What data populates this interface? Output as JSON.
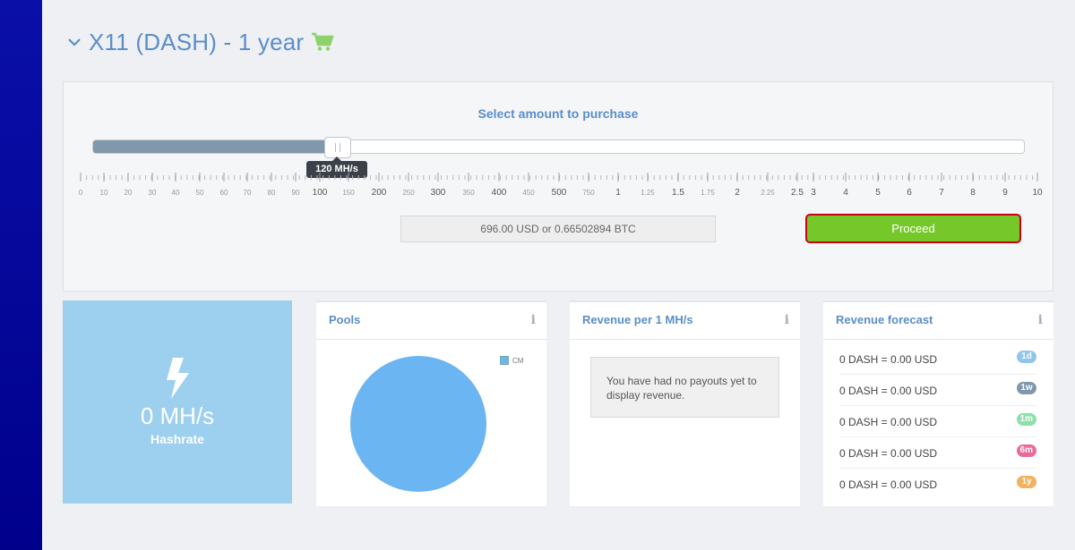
{
  "header": {
    "title": "X11 (DASH) - 1 year"
  },
  "purchase": {
    "label": "Select amount to purchase",
    "tooltip": "120 MH/s",
    "slider_fraction": 0.262,
    "scale_major": [
      {
        "label": "0",
        "kind": "small"
      },
      {
        "label": "10",
        "kind": "small"
      },
      {
        "label": "20",
        "kind": "small"
      },
      {
        "label": "30",
        "kind": "small"
      },
      {
        "label": "40",
        "kind": "small"
      },
      {
        "label": "50",
        "kind": "small"
      },
      {
        "label": "60",
        "kind": "small"
      },
      {
        "label": "70",
        "kind": "small"
      },
      {
        "label": "80",
        "kind": "small"
      },
      {
        "label": "90",
        "kind": "small"
      },
      {
        "label": "100",
        "kind": "big"
      },
      {
        "label": "150",
        "kind": "small"
      },
      {
        "label": "200",
        "kind": "big"
      },
      {
        "label": "250",
        "kind": "small"
      },
      {
        "label": "300",
        "kind": "big"
      },
      {
        "label": "350",
        "kind": "small"
      },
      {
        "label": "400",
        "kind": "big"
      },
      {
        "label": "450",
        "kind": "small"
      },
      {
        "label": "500",
        "kind": "big"
      },
      {
        "label": "750",
        "kind": "small"
      },
      {
        "label": "1",
        "kind": "big"
      },
      {
        "label": "1.25",
        "kind": "small"
      },
      {
        "label": "1.5",
        "kind": "big"
      },
      {
        "label": "1.75",
        "kind": "small"
      },
      {
        "label": "2",
        "kind": "big"
      },
      {
        "label": "2.25",
        "kind": "small"
      },
      {
        "label": "2.5",
        "kind": "big"
      },
      {
        "label": "3",
        "kind": "big"
      },
      {
        "label": "4",
        "kind": "big"
      },
      {
        "label": "5",
        "kind": "big"
      },
      {
        "label": "6",
        "kind": "big"
      },
      {
        "label": "7",
        "kind": "big"
      },
      {
        "label": "8",
        "kind": "big"
      },
      {
        "label": "9",
        "kind": "big"
      },
      {
        "label": "10",
        "kind": "big"
      }
    ],
    "price": "696.00 USD or 0.66502894 BTC",
    "proceed_label": "Proceed"
  },
  "hashrate": {
    "value": "0 MH/s",
    "label": "Hashrate",
    "icon": "bolt-icon"
  },
  "pools": {
    "title": "Pools",
    "legend": "CM",
    "color": "#6bb5f2",
    "info_icon": "i"
  },
  "revenue": {
    "title": "Revenue per 1 MH/s",
    "message": "You have had no payouts yet to display revenue.",
    "info_icon": "i"
  },
  "forecast": {
    "title": "Revenue forecast",
    "info_icon": "i",
    "rows": [
      {
        "text": "0 DASH = 0.00 USD",
        "badge": "1d",
        "color": "#8fc7ec"
      },
      {
        "text": "0 DASH = 0.00 USD",
        "badge": "1w",
        "color": "#7f98ae"
      },
      {
        "text": "0 DASH = 0.00 USD",
        "badge": "1m",
        "color": "#8ee0a8"
      },
      {
        "text": "0 DASH = 0.00 USD",
        "badge": "6m",
        "color": "#e86a9a"
      },
      {
        "text": "0 DASH = 0.00 USD",
        "badge": "1y",
        "color": "#f1b15d"
      }
    ]
  },
  "colors": {
    "accent": "#5b8ec9",
    "proceed": "#76c82a",
    "sidebar": "#0a0fa8"
  }
}
